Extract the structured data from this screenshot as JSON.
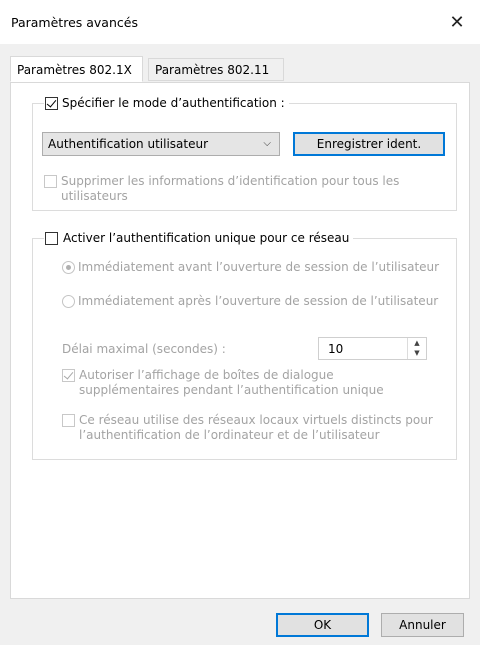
{
  "window": {
    "title": "Paramètres avancés",
    "close_glyph": "✕"
  },
  "tabs": [
    {
      "label": "Paramètres 802.1X",
      "active": true
    },
    {
      "label": "Paramètres 802.11",
      "active": false
    }
  ],
  "auth_group": {
    "specify_mode_label": "Spécifier le mode d’authentification :",
    "specify_mode_checked": true,
    "mode_selected": "Authentification utilisateur",
    "save_credentials_label": "Enregistrer ident.",
    "delete_credentials_label": "Supprimer les informations d’identification pour tous les utilisateurs",
    "delete_credentials_checked": false
  },
  "sso_group": {
    "enable_sso_label": "Activer l’authentification unique pour ce réseau",
    "enable_sso_checked": false,
    "radio_before_label": "Immédiatement avant l’ouverture de session de l’utilisateur",
    "radio_before_checked": true,
    "radio_after_label": "Immédiatement après l’ouverture de session de l’utilisateur",
    "radio_after_checked": false,
    "max_delay_label": "Délai maximal (secondes) :",
    "max_delay_value": "10",
    "allow_dialogs_label": "Autoriser l’affichage de boîtes de dialogue supplémentaires pendant l’authentification unique",
    "allow_dialogs_checked": true,
    "vlan_label": "Ce réseau utilise des réseaux locaux virtuels distincts pour l’authentification de l’ordinateur et de l’utilisateur",
    "vlan_checked": false
  },
  "footer": {
    "ok_label": "OK",
    "cancel_label": "Annuler"
  },
  "colors": {
    "accent": "#0078d7",
    "disabled_text": "#a3a3a3"
  }
}
